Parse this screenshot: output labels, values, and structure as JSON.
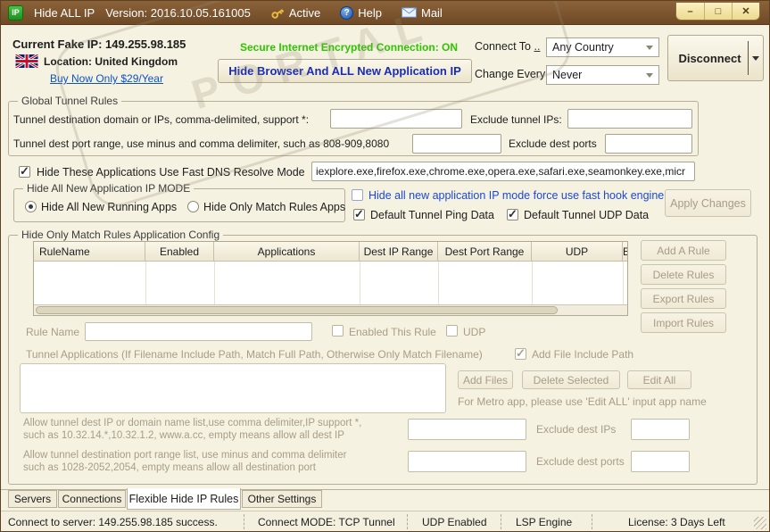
{
  "window": {
    "app_title": "Hide ALL IP",
    "version": "Version: 2016.10.05.161005",
    "menu_active": "Active",
    "menu_help": "Help",
    "menu_mail": "Mail",
    "btn_min": "–",
    "btn_max": "□",
    "btn_close": "✕",
    "watermark": "PORTAL"
  },
  "top": {
    "fake_ip": "Current Fake IP: 149.255.98.185",
    "location": "Location: United Kingdom",
    "buy_link": "Buy Now Only $29/Year",
    "secure_status": "Secure Internet Encrypted Connection: ON",
    "hide_browser_btn": "Hide Browser And ALL New Application IP",
    "connect_to_label": "Connect To",
    "connect_to_dots": "..",
    "connect_to_value": "Any Country",
    "change_every_label": "Change Every",
    "change_every_value": "Never",
    "disconnect_btn": "Disconnect"
  },
  "global_rules": {
    "title": "Global Tunnel Rules",
    "dest_label": "Tunnel destination domain or IPs, comma-delimited, support *:",
    "exclude_ips_label": "Exclude tunnel IPs:",
    "port_label": "Tunnel dest port range, use minus and comma delimiter, such as 808-909,8080",
    "exclude_ports_label": "Exclude dest ports"
  },
  "dns": {
    "label": "Hide These Applications Use Fast DNS Resolve Mode",
    "apps": "iexplore.exe,firefox.exe,chrome.exe,opera.exe,safari.exe,seamonkey.exe,micr"
  },
  "mode": {
    "title": "Hide All New Application IP MODE",
    "radio_all": "Hide All New Running Apps",
    "radio_match": "Hide Only Match Rules Apps",
    "hook_label": "Hide all new application IP mode force use fast hook engine",
    "ping_label": "Default Tunnel Ping Data",
    "udp_label": "Default Tunnel UDP Data",
    "apply_btn": "Apply Changes"
  },
  "rules": {
    "title": "Hide Only Match Rules Application Config",
    "headers": [
      "RuleName",
      "Enabled",
      "Applications",
      "Dest IP Range",
      "Dest Port Range",
      "UDP",
      "E"
    ],
    "side_buttons": [
      "Add A Rule",
      "Delete Rules",
      "Export Rules",
      "Import Rules"
    ],
    "rule_name_label": "Rule Name",
    "enabled_label": "Enabled This Rule",
    "udp_label": "UDP",
    "apps_label": "Tunnel Applications (If Filename Include Path, Match Full Path, Otherwise Only Match Filename)",
    "include_path_label": "Add File Include Path",
    "add_files_btn": "Add Files",
    "delete_selected_btn": "Delete Selected",
    "edit_all_btn": "Edit All",
    "metro_note": "For Metro app, please use 'Edit ALL' input app name",
    "allow_ip_line1": "Allow tunnel dest IP or domain name list,use comma delimiter,IP support *,",
    "allow_ip_line2": "such as 10.32.14.*,10.32.1.2, www.a.cc, empty means allow all dest IP",
    "exclude_ips_label": "Exclude dest IPs",
    "allow_port_line1": "Allow tunnel destination port range list, use minus and comma delimiter",
    "allow_port_line2": "such as 1028-2052,2054, empty means allow all destination port",
    "exclude_ports_label": "Exclude dest ports"
  },
  "tabs": [
    "Servers",
    "Connections",
    "Flexible Hide IP Rules",
    "Other Settings"
  ],
  "status": [
    "Connect to server: 149.255.98.185 success.",
    "Connect MODE: TCP Tunnel",
    "UDP Enabled",
    "LSP Engine",
    "License: 3 Days Left"
  ]
}
